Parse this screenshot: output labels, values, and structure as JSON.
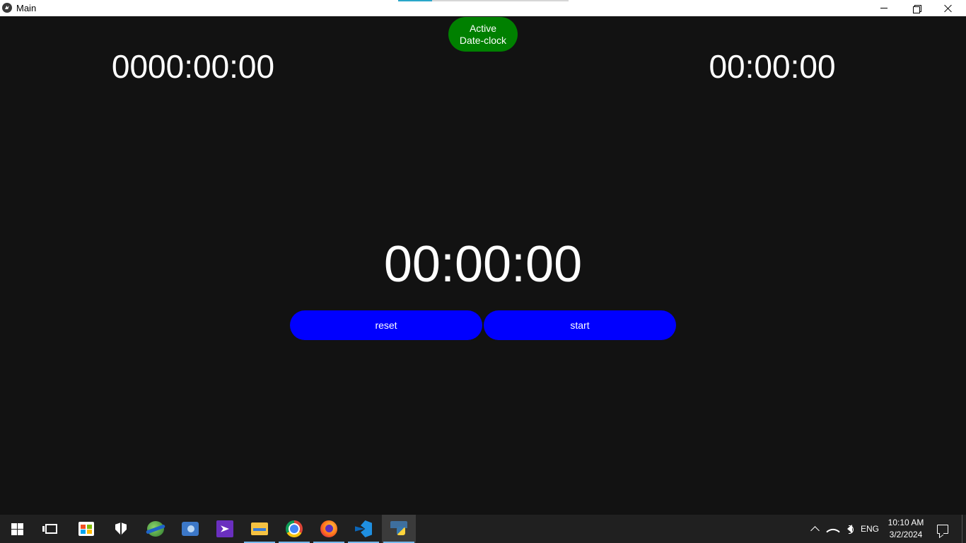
{
  "window": {
    "title": "Main",
    "minimize_icon": "minimize-icon",
    "restore_icon": "restore-icon",
    "close_icon": "close-icon"
  },
  "app": {
    "badge_line1": "Active",
    "badge_line2": "Date-clock",
    "badge_color": "#008000",
    "clock_left": "0000:00:00",
    "clock_right": "00:00:00",
    "clock_main": "00:00:00",
    "reset_label": "reset",
    "start_label": "start",
    "button_color": "#0000ff",
    "background_color": "#121212"
  },
  "taskbar": {
    "pinned": [
      {
        "name": "start-icon"
      },
      {
        "name": "task-view-icon"
      },
      {
        "name": "microsoft-store-icon"
      },
      {
        "name": "windows-security-icon"
      },
      {
        "name": "globe-app-icon"
      },
      {
        "name": "network-app-icon"
      },
      {
        "name": "visual-studio-icon"
      },
      {
        "name": "file-explorer-icon"
      },
      {
        "name": "chrome-icon"
      },
      {
        "name": "firefox-icon"
      },
      {
        "name": "vscode-icon"
      },
      {
        "name": "python-app-icon"
      }
    ],
    "tray": {
      "language": "ENG",
      "time": "10:10 AM",
      "date": "3/2/2024"
    }
  }
}
